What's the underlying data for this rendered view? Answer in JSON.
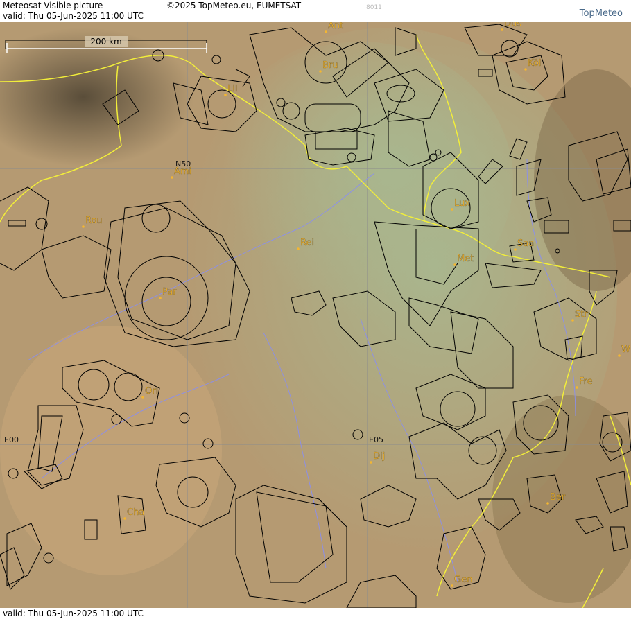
{
  "header": {
    "product": "Meteosat Visible picture",
    "valid": "valid:  Thu  05-Jun-2025  11:00 UTC",
    "copyright": "©2025 TopMeteo.eu, EUMETSAT",
    "code": "8011",
    "logo": "TopMeteo"
  },
  "footer": {
    "valid": "valid:  Thu  05-Jun-2025  11:00 UTC"
  },
  "map": {
    "scale_label": "200 km",
    "grid_labels": {
      "lat": "N50",
      "lon_w": "E00",
      "lon_e": "E05"
    },
    "cities": [
      "Ant",
      "Düs",
      "Bru",
      "Köl",
      "Lil",
      "Ami",
      "Rou",
      "Rei",
      "Lux",
      "Saa",
      "Met",
      "Par",
      "Str",
      "Fre",
      "Orl",
      "Dij",
      "Ber",
      "Cha",
      "Gen",
      "W"
    ],
    "colors": {
      "border": "#f2ee3a",
      "river": "#8a8ef0",
      "city": "#f3b632",
      "airspace": "#000000",
      "grid": "#8c8c8c"
    },
    "icon": "satellite-image"
  }
}
